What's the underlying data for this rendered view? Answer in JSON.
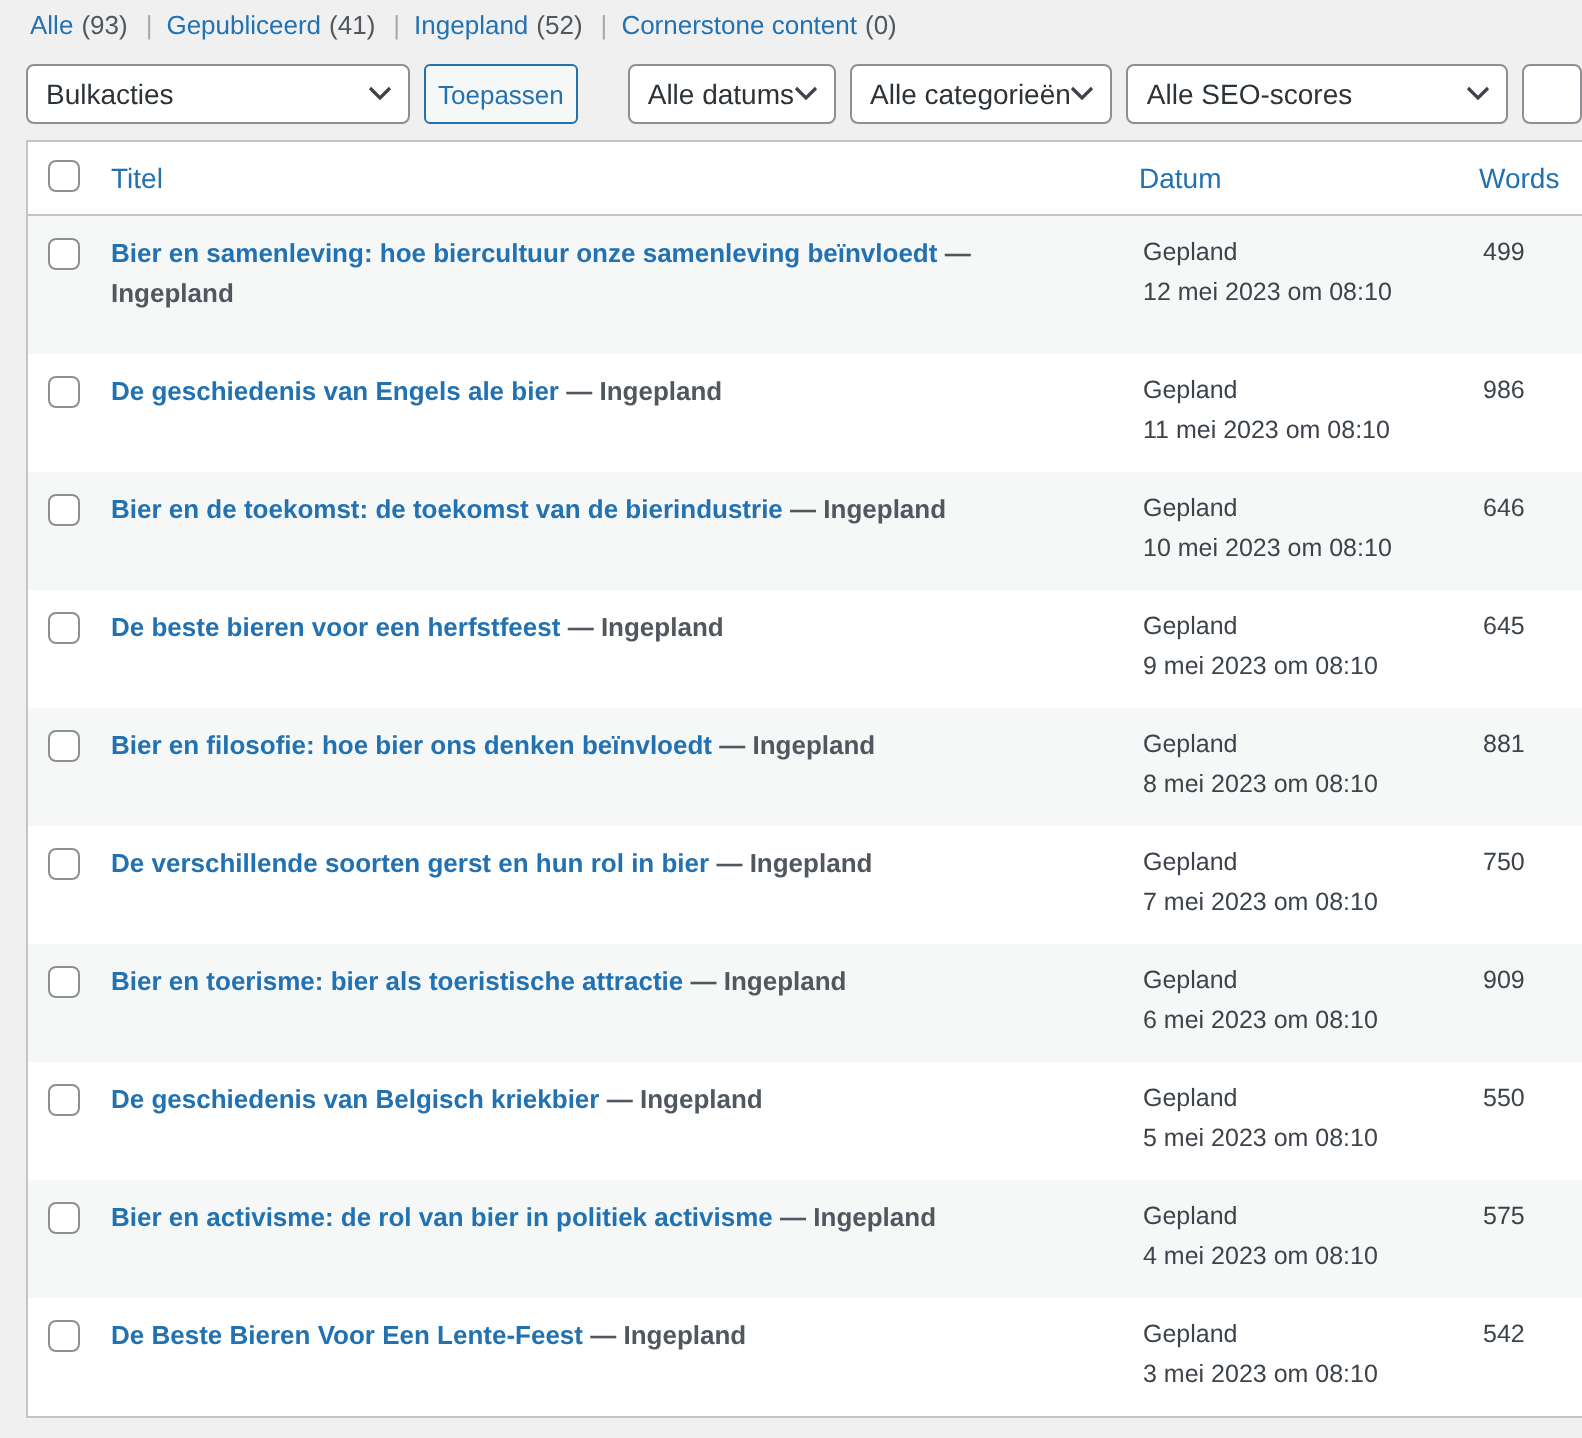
{
  "views": [
    {
      "label": "Alle",
      "count": "(93)"
    },
    {
      "label": "Gepubliceerd",
      "count": "(41)"
    },
    {
      "label": "Ingepland",
      "count": "(52)"
    },
    {
      "label": "Cornerstone content",
      "count": "(0)"
    }
  ],
  "view_separator": "|",
  "bulk_select": "Bulkacties",
  "apply_button": "Toepassen",
  "filters": [
    "Alle datums",
    "Alle categorieën",
    "Alle SEO-scores"
  ],
  "table": {
    "select_all_checked": false,
    "columns": [
      "Titel",
      "Datum",
      "Words"
    ],
    "rows": [
      {
        "title": "Bier en samenleving: hoe biercultuur onze samenleving beïnvloedt",
        "state": "— Ingepland",
        "status": "Gepland",
        "date": "12 mei 2023 om 08:10",
        "words": "499",
        "checked": false
      },
      {
        "title": "De geschiedenis van Engels ale bier",
        "state": "— Ingepland",
        "status": "Gepland",
        "date": "11 mei 2023 om 08:10",
        "words": "986",
        "checked": false
      },
      {
        "title": "Bier en de toekomst: de toekomst van de bierindustrie",
        "state": "— Ingepland",
        "status": "Gepland",
        "date": "10 mei 2023 om 08:10",
        "words": "646",
        "checked": false
      },
      {
        "title": "De beste bieren voor een herfstfeest",
        "state": "— Ingepland",
        "status": "Gepland",
        "date": "9 mei 2023 om 08:10",
        "words": "645",
        "checked": false
      },
      {
        "title": "Bier en filosofie: hoe bier ons denken beïnvloedt",
        "state": "— Ingepland",
        "status": "Gepland",
        "date": "8 mei 2023 om 08:10",
        "words": "881",
        "checked": false
      },
      {
        "title": "De verschillende soorten gerst en hun rol in bier",
        "state": "— Ingepland",
        "status": "Gepland",
        "date": "7 mei 2023 om 08:10",
        "words": "750",
        "checked": false
      },
      {
        "title": "Bier en toerisme: bier als toeristische attractie",
        "state": "— Ingepland",
        "status": "Gepland",
        "date": "6 mei 2023 om 08:10",
        "words": "909",
        "checked": false
      },
      {
        "title": "De geschiedenis van Belgisch kriekbier",
        "state": "— Ingepland",
        "status": "Gepland",
        "date": "5 mei 2023 om 08:10",
        "words": "550",
        "checked": false
      },
      {
        "title": "Bier en activisme: de rol van bier in politiek activisme",
        "state": "— Ingepland",
        "status": "Gepland",
        "date": "4 mei 2023 om 08:10",
        "words": "575",
        "checked": false
      },
      {
        "title": "De Beste Bieren Voor Een Lente-Feest",
        "state": "— Ingepland",
        "status": "Gepland",
        "date": "3 mei 2023 om 08:10",
        "words": "542",
        "checked": false
      }
    ]
  }
}
